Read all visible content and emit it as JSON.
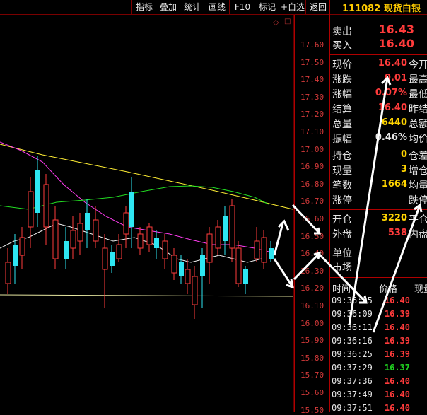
{
  "toolbar": {
    "buttons": [
      "指标",
      "叠加",
      "统计",
      "画线",
      "F10",
      "标记",
      "+自选",
      "返回"
    ]
  },
  "instrument": {
    "code": "111082",
    "name": "现货白银"
  },
  "price_axis": [
    "17.60",
    "17.50",
    "17.40",
    "17.30",
    "17.20",
    "17.10",
    "17.00",
    "16.90",
    "16.80",
    "16.70",
    "16.60",
    "16.50",
    "16.40",
    "16.30",
    "16.20",
    "16.10",
    "16.00",
    "15.90",
    "15.80",
    "15.70",
    "15.60",
    "15.50"
  ],
  "quote": {
    "sell_label": "卖出",
    "sell_value": "16.43",
    "buy_label": "买入",
    "buy_value": "16.40"
  },
  "stats": {
    "rows": [
      {
        "label": "现价",
        "value": "16.40",
        "color": "red",
        "right": "今开"
      },
      {
        "label": "涨跌",
        "value": "0.01",
        "color": "red",
        "right": "最高"
      },
      {
        "label": "涨幅",
        "value": "0.07%",
        "color": "red",
        "right": "最低"
      },
      {
        "label": "结算",
        "value": "16.40",
        "color": "red",
        "right": "昨结"
      },
      {
        "label": "总量",
        "value": "6440",
        "color": "yel",
        "right": "总额"
      },
      {
        "label": "振幅",
        "value": "0.46%",
        "color": "wht",
        "right": "均价"
      }
    ]
  },
  "position": {
    "rows": [
      {
        "label": "持仓",
        "value": "0",
        "color": "yel",
        "right": "仓差"
      },
      {
        "label": "现量",
        "value": "3",
        "color": "yel",
        "right": "增仓"
      },
      {
        "label": "笔数",
        "value": "1664",
        "color": "yel",
        "right": "均量"
      },
      {
        "label": "涨停",
        "value": "",
        "color": "wht",
        "right": "跌停"
      }
    ]
  },
  "trade_side": {
    "rows": [
      {
        "label": "开仓",
        "value": "3220",
        "color": "yel",
        "right": "平仓"
      },
      {
        "label": "外盘",
        "value": "538",
        "color": "red",
        "right": "内盘"
      }
    ]
  },
  "unit": {
    "unit_label": "单位",
    "market_label": "市场"
  },
  "ticks": {
    "header_time": "时间",
    "header_price": "价格",
    "header_qty": "现量",
    "rows": [
      {
        "time": "09:36:05",
        "price": "16.40",
        "color": "red"
      },
      {
        "time": "09:36:09",
        "price": "16.39",
        "color": "red"
      },
      {
        "time": "09:36:11",
        "price": "16.40",
        "color": "red"
      },
      {
        "time": "09:36:16",
        "price": "16.39",
        "color": "red"
      },
      {
        "time": "09:36:25",
        "price": "16.39",
        "color": "red"
      },
      {
        "time": "09:37:29",
        "price": "16.37",
        "color": "green"
      },
      {
        "time": "09:37:36",
        "price": "16.40",
        "color": "red"
      },
      {
        "time": "09:37:49",
        "price": "16.40",
        "color": "red"
      },
      {
        "time": "09:37:51",
        "price": "16.40",
        "color": "red"
      }
    ]
  },
  "colors": {
    "up": "#ff3b3b",
    "down": "#2ee6f2",
    "ma_yellow": "#ffee33",
    "ma_white": "#f0f0f0",
    "ma_magenta": "#ff3df0",
    "ma_green": "#22dd22",
    "border": "#b00000"
  }
}
